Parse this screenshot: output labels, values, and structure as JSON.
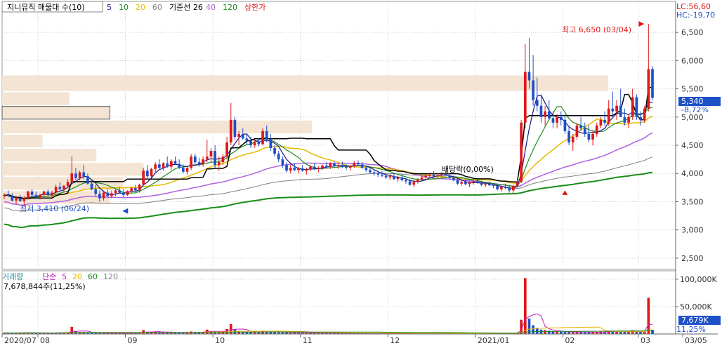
{
  "legend": {
    "title": "지니뮤직 매물대 수(10)",
    "ma_items": [
      {
        "label": "5",
        "color": "#1a1a80"
      },
      {
        "label": "10",
        "color": "#1e8c1e"
      },
      {
        "label": "20",
        "color": "#e8b800"
      },
      {
        "label": "60",
        "color": "#808080"
      },
      {
        "label": "기준선 26",
        "color": "#000000"
      },
      {
        "label": "40",
        "color": "#b060e0"
      },
      {
        "label": "120",
        "color": "#1a8c1a"
      },
      {
        "label": "상한가",
        "color": "#e01818"
      }
    ]
  },
  "limits": {
    "lc": "LC:56,60",
    "hc": "HC:-19,70"
  },
  "price_axis": {
    "ticks": [
      "6,500",
      "6,000",
      "5,500",
      "5,000",
      "4,500",
      "4,000",
      "3,500",
      "3,000",
      "2,500"
    ],
    "current_price": "5,340",
    "current_change": "-8,72%"
  },
  "annotations": {
    "high": "최고 6,650 (03/04)",
    "low": "최저 3,410 (06/24)",
    "dividend": "배당락(0,00%)"
  },
  "volume_panel": {
    "legend": {
      "label": "거래량",
      "type": "단순",
      "periods": [
        "5",
        "20",
        "60",
        "120"
      ]
    },
    "current_volume": "7,678,844주(11,25%)",
    "ticks": [
      "100,000K",
      "50,000K"
    ],
    "current_tag": "7,679K",
    "current_pct": "11,25%"
  },
  "x_axis": {
    "labels": [
      "2020/07",
      "08",
      "09",
      "10",
      "11",
      "12",
      "2021/01",
      "02",
      "03",
      "03/05"
    ]
  },
  "chart_data": {
    "type": "candlestick",
    "title": "지니뮤직 매물대 수(10)",
    "y_range": [
      2300,
      6800
    ],
    "volume_range_k": [
      0,
      105000
    ],
    "high": {
      "value": 6650,
      "date": "03/04"
    },
    "low": {
      "value": 3410,
      "date": "06/24"
    },
    "volume_profile_levels": [
      {
        "price_low": 5450,
        "price_high": 5750,
        "strength": 0.9
      },
      {
        "price_low": 5200,
        "price_high": 5450,
        "strength": 0.1
      },
      {
        "price_low": 4950,
        "price_high": 5200,
        "strength": 0.16
      },
      {
        "price_low": 4700,
        "price_high": 4950,
        "strength": 0.46
      },
      {
        "price_low": 4450,
        "price_high": 4700,
        "strength": 0.06
      },
      {
        "price_low": 4200,
        "price_high": 4450,
        "strength": 0.14
      },
      {
        "price_low": 3950,
        "price_high": 4200,
        "strength": 0.21
      },
      {
        "price_low": 3700,
        "price_high": 3950,
        "strength": 0.18
      },
      {
        "price_low": 3450,
        "price_high": 3700,
        "strength": 0.16
      }
    ],
    "candles": [
      [
        3600,
        3650,
        3550,
        3620,
        2000
      ],
      [
        3620,
        3700,
        3580,
        3600,
        1800
      ],
      [
        3600,
        3650,
        3500,
        3520,
        2100
      ],
      [
        3520,
        3600,
        3450,
        3560,
        1900
      ],
      [
        3560,
        3620,
        3500,
        3510,
        1700
      ],
      [
        3510,
        3600,
        3410,
        3560,
        2600
      ],
      [
        3560,
        3700,
        3540,
        3680,
        2300
      ],
      [
        3680,
        3720,
        3600,
        3620,
        1900
      ],
      [
        3620,
        3680,
        3560,
        3580,
        1700
      ],
      [
        3580,
        3640,
        3540,
        3620,
        1600
      ],
      [
        3620,
        3700,
        3600,
        3680,
        2000
      ],
      [
        3680,
        3720,
        3600,
        3620,
        1800
      ],
      [
        3620,
        3700,
        3580,
        3660,
        1700
      ],
      [
        3660,
        3800,
        3640,
        3760,
        2600
      ],
      [
        3760,
        3850,
        3700,
        3720,
        2400
      ],
      [
        3720,
        3800,
        3660,
        3780,
        2100
      ],
      [
        3780,
        3900,
        3740,
        3850,
        2700
      ],
      [
        3850,
        4300,
        3820,
        4000,
        13000
      ],
      [
        4000,
        4100,
        3880,
        3920,
        5000
      ],
      [
        3920,
        4050,
        3880,
        4020,
        3200
      ],
      [
        4020,
        4150,
        3900,
        3950,
        3100
      ],
      [
        3950,
        4000,
        3800,
        3820,
        2500
      ],
      [
        3820,
        3900,
        3700,
        3720,
        2100
      ],
      [
        3720,
        3800,
        3600,
        3640,
        1900
      ],
      [
        3640,
        3700,
        3500,
        3560,
        1800
      ],
      [
        3560,
        3700,
        3520,
        3660,
        1900
      ],
      [
        3660,
        3720,
        3580,
        3600,
        1600
      ],
      [
        3600,
        3700,
        3560,
        3650,
        1700
      ],
      [
        3650,
        3720,
        3600,
        3700,
        1800
      ],
      [
        3700,
        3760,
        3640,
        3660,
        1700
      ],
      [
        3660,
        3720,
        3580,
        3620,
        1600
      ],
      [
        3620,
        3700,
        3600,
        3690,
        1800
      ],
      [
        3690,
        3760,
        3650,
        3740,
        1900
      ],
      [
        3740,
        3800,
        3680,
        3700,
        1700
      ],
      [
        3700,
        3820,
        3660,
        3800,
        2000
      ],
      [
        3800,
        4100,
        3780,
        4050,
        7000
      ],
      [
        4050,
        4150,
        3900,
        3950,
        4000
      ],
      [
        3950,
        4100,
        3920,
        4080,
        3600
      ],
      [
        4080,
        4200,
        4000,
        4160,
        3800
      ],
      [
        4160,
        4250,
        4080,
        4100,
        3400
      ],
      [
        4100,
        4200,
        4050,
        4180,
        3200
      ],
      [
        4180,
        4300,
        4100,
        4120,
        3100
      ],
      [
        4120,
        4250,
        4060,
        4220,
        3000
      ],
      [
        4220,
        4300,
        4150,
        4170,
        2800
      ],
      [
        4170,
        4250,
        4080,
        4100,
        2600
      ],
      [
        4100,
        4160,
        4000,
        4030,
        2400
      ],
      [
        4030,
        4120,
        3980,
        4100,
        2500
      ],
      [
        4100,
        4350,
        4060,
        4300,
        4500
      ],
      [
        4300,
        4350,
        4150,
        4200,
        3500
      ],
      [
        4200,
        4280,
        4120,
        4160,
        3000
      ],
      [
        4160,
        4300,
        4120,
        4250,
        3300
      ],
      [
        4250,
        4600,
        4200,
        4300,
        8000
      ],
      [
        4300,
        4450,
        4200,
        4400,
        5200
      ],
      [
        4400,
        4500,
        4100,
        4150,
        4100
      ],
      [
        4150,
        4300,
        4050,
        4200,
        3500
      ],
      [
        4200,
        4350,
        4150,
        4300,
        3600
      ],
      [
        4300,
        4650,
        4250,
        4550,
        9000
      ],
      [
        4550,
        5250,
        4500,
        4950,
        18000
      ],
      [
        4950,
        5000,
        4600,
        4650,
        8500
      ],
      [
        4650,
        4750,
        4500,
        4700,
        5000
      ],
      [
        4700,
        4800,
        4600,
        4620,
        4000
      ],
      [
        4620,
        4700,
        4500,
        4580,
        3600
      ],
      [
        4580,
        4650,
        4450,
        4500,
        3300
      ],
      [
        4500,
        4600,
        4450,
        4550,
        3000
      ],
      [
        4550,
        4620,
        4480,
        4520,
        2800
      ],
      [
        4520,
        4800,
        4500,
        4750,
        5500
      ],
      [
        4750,
        4850,
        4550,
        4600,
        4400
      ],
      [
        4600,
        4700,
        4400,
        4450,
        3600
      ],
      [
        4450,
        4500,
        4300,
        4350,
        3200
      ],
      [
        4350,
        4400,
        4200,
        4250,
        3000
      ],
      [
        4250,
        4300,
        4100,
        4150,
        2800
      ],
      [
        4150,
        4200,
        4020,
        4050,
        2600
      ],
      [
        4050,
        4150,
        4000,
        4100,
        2400
      ],
      [
        4100,
        4180,
        4040,
        4060,
        2200
      ],
      [
        4060,
        4120,
        4000,
        4090,
        2200
      ],
      [
        4090,
        4150,
        4030,
        4050,
        2000
      ],
      [
        4050,
        4100,
        3980,
        4070,
        2000
      ],
      [
        4070,
        4150,
        4040,
        4120,
        2100
      ],
      [
        4120,
        4180,
        4060,
        4080,
        1900
      ],
      [
        4080,
        4130,
        4020,
        4100,
        1800
      ],
      [
        4100,
        4160,
        4060,
        4140,
        1900
      ],
      [
        4140,
        4200,
        4100,
        4120,
        1800
      ],
      [
        4120,
        4200,
        4080,
        4180,
        1800
      ],
      [
        4180,
        4220,
        4110,
        4130,
        1700
      ],
      [
        4130,
        4180,
        4080,
        4150,
        1700
      ],
      [
        4150,
        4210,
        4100,
        4120,
        1600
      ],
      [
        4120,
        4160,
        4060,
        4100,
        1600
      ],
      [
        4100,
        4150,
        4050,
        4140,
        1700
      ],
      [
        4140,
        4220,
        4100,
        4190,
        1800
      ],
      [
        4190,
        4230,
        4140,
        4160,
        1700
      ],
      [
        4160,
        4200,
        4080,
        4100,
        1600
      ],
      [
        4100,
        4140,
        4030,
        4060,
        1600
      ],
      [
        4060,
        4110,
        4000,
        4020,
        1500
      ],
      [
        4020,
        4070,
        3960,
        4000,
        1500
      ],
      [
        4000,
        4050,
        3940,
        3980,
        1400
      ],
      [
        3980,
        4040,
        3930,
        3960,
        1400
      ],
      [
        3960,
        4000,
        3900,
        3930,
        1300
      ],
      [
        3930,
        3990,
        3880,
        3950,
        1300
      ],
      [
        3950,
        4000,
        3880,
        3900,
        1300
      ],
      [
        3900,
        3960,
        3850,
        3930,
        1300
      ],
      [
        3930,
        3980,
        3860,
        3880,
        1200
      ],
      [
        3880,
        3920,
        3820,
        3860,
        1200
      ],
      [
        3860,
        3900,
        3780,
        3800,
        1300
      ],
      [
        3800,
        3880,
        3760,
        3850,
        1300
      ],
      [
        3850,
        3920,
        3820,
        3890,
        1300
      ],
      [
        3890,
        3960,
        3860,
        3930,
        1400
      ],
      [
        3930,
        3990,
        3900,
        3960,
        1400
      ],
      [
        3960,
        4020,
        3920,
        3980,
        1500
      ],
      [
        3980,
        4040,
        3930,
        3950,
        1400
      ],
      [
        3950,
        4000,
        3900,
        3970,
        1400
      ],
      [
        3970,
        4030,
        3940,
        3990,
        1300
      ],
      [
        3990,
        4050,
        3960,
        3960,
        1400
      ],
      [
        3960,
        4000,
        3900,
        3920,
        1300
      ],
      [
        3920,
        3960,
        3860,
        3880,
        1200
      ],
      [
        3880,
        3920,
        3800,
        3820,
        1200
      ],
      [
        3820,
        3880,
        3780,
        3850,
        1200
      ],
      [
        3850,
        3900,
        3790,
        3810,
        1100
      ],
      [
        3810,
        3860,
        3760,
        3840,
        1100
      ],
      [
        3840,
        3880,
        3800,
        3860,
        1100
      ],
      [
        3860,
        3900,
        3820,
        3830,
        1100
      ],
      [
        3830,
        3870,
        3780,
        3800,
        1100
      ],
      [
        3800,
        3850,
        3760,
        3820,
        1100
      ],
      [
        3820,
        3860,
        3780,
        3790,
        1000
      ],
      [
        3790,
        3830,
        3740,
        3780,
        1000
      ],
      [
        3780,
        3820,
        3700,
        3720,
        1200
      ],
      [
        3720,
        3780,
        3680,
        3760,
        1100
      ],
      [
        3760,
        3820,
        3720,
        3740,
        1100
      ],
      [
        3740,
        3800,
        3660,
        3700,
        1300
      ],
      [
        3700,
        3800,
        3650,
        3780,
        1400
      ],
      [
        3780,
        3900,
        3750,
        3850,
        2500
      ],
      [
        3850,
        4950,
        3830,
        4900,
        26000
      ],
      [
        4900,
        6300,
        4800,
        5800,
        102000
      ],
      [
        5800,
        6400,
        5500,
        5650,
        28000
      ],
      [
        5650,
        6100,
        5200,
        5300,
        16000
      ],
      [
        5300,
        5700,
        5100,
        5200,
        11000
      ],
      [
        5200,
        5400,
        4900,
        5000,
        8000
      ],
      [
        5000,
        5200,
        4850,
        5100,
        7000
      ],
      [
        5100,
        5300,
        4950,
        4980,
        6000
      ],
      [
        4980,
        5100,
        4800,
        4900,
        5000
      ],
      [
        4900,
        5050,
        4800,
        5000,
        4600
      ],
      [
        5000,
        5100,
        4850,
        4950,
        4200
      ],
      [
        4950,
        5050,
        4700,
        4750,
        4000
      ],
      [
        4750,
        4850,
        4500,
        4550,
        3800
      ],
      [
        4550,
        4700,
        4400,
        4650,
        3400
      ],
      [
        4650,
        4900,
        4600,
        4850,
        4000
      ],
      [
        4850,
        5000,
        4750,
        4800,
        3600
      ],
      [
        4800,
        4900,
        4650,
        4700,
        3200
      ],
      [
        4700,
        4850,
        4550,
        4600,
        3000
      ],
      [
        4600,
        4750,
        4500,
        4700,
        3000
      ],
      [
        4700,
        4900,
        4650,
        4850,
        3500
      ],
      [
        4850,
        5000,
        4800,
        4950,
        4200
      ],
      [
        4950,
        5100,
        4850,
        4900,
        3800
      ],
      [
        4900,
        5300,
        4850,
        5150,
        5200
      ],
      [
        5150,
        5450,
        5000,
        5100,
        6000
      ],
      [
        5100,
        5300,
        4950,
        5200,
        4800
      ],
      [
        5200,
        5500,
        5050,
        5000,
        5000
      ],
      [
        5000,
        5150,
        4850,
        4900,
        4000
      ],
      [
        4900,
        5050,
        4800,
        5000,
        3800
      ],
      [
        5000,
        5500,
        4950,
        5350,
        7000
      ],
      [
        5350,
        5400,
        4950,
        5000,
        5500
      ],
      [
        5000,
        5100,
        4850,
        4950,
        4200
      ],
      [
        4950,
        5200,
        4900,
        5150,
        4600
      ],
      [
        5150,
        6650,
        5100,
        5850,
        66000
      ],
      [
        5850,
        5900,
        5300,
        5340,
        7679
      ]
    ]
  }
}
